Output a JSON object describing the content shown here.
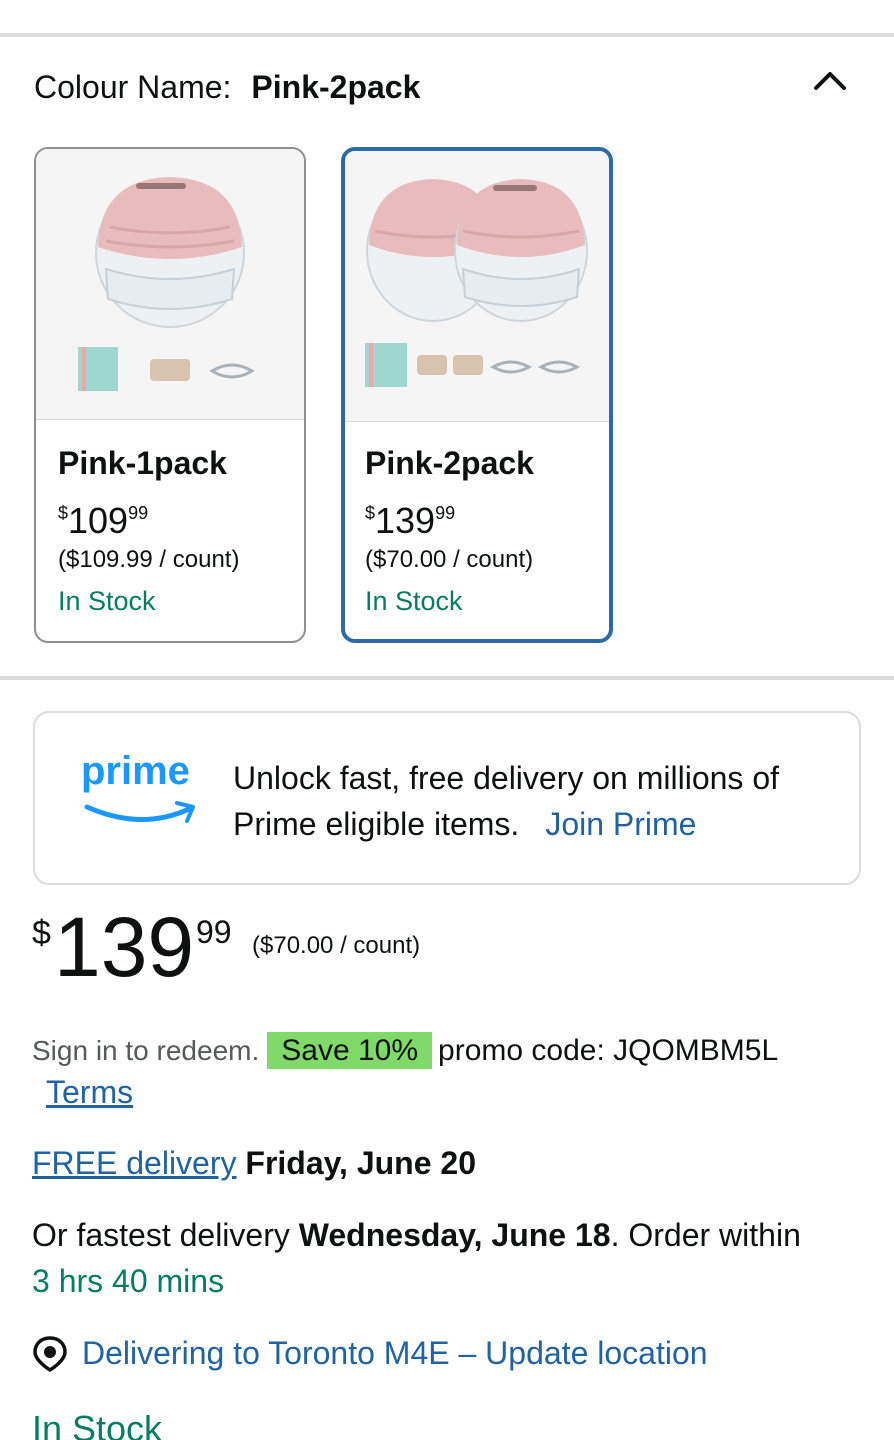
{
  "variation": {
    "label": "Colour Name:",
    "selected_value": "Pink-2pack"
  },
  "swatches": [
    {
      "name": "Pink-1pack",
      "price_symbol": "$",
      "price_whole": "109",
      "price_fraction": "99",
      "unit_price": "($109.99 / count)",
      "availability": "In Stock",
      "selected": false
    },
    {
      "name": "Pink-2pack",
      "price_symbol": "$",
      "price_whole": "139",
      "price_fraction": "99",
      "unit_price": "($70.00 / count)",
      "availability": "In Stock",
      "selected": true
    }
  ],
  "prime": {
    "logo_text": "prime",
    "message": "Unlock fast, free delivery on millions of Prime eligible items.",
    "join_label": "Join Prime"
  },
  "price": {
    "symbol": "$",
    "whole": "139",
    "fraction": "99",
    "unit_price": "($70.00 / count)"
  },
  "promo": {
    "sign_in": "Sign in to redeem.",
    "badge": "Save 10%",
    "code_text": "promo code: JQOMBM5L",
    "terms_label": "Terms"
  },
  "delivery": {
    "free_link": "FREE delivery",
    "free_date": "Friday, June 20",
    "fastest_prefix": "Or fastest delivery",
    "fastest_date": "Wednesday, June 18",
    "order_within_prefix": ". Order within",
    "countdown": "3 hrs 40 mins"
  },
  "location": {
    "text": "Delivering to Toronto M4E – Update location"
  },
  "availability": "In Stock",
  "colors": {
    "link": "#2162a1",
    "in_stock": "#067d62",
    "selected_border": "#2c6aa8",
    "promo_badge": "#7fda69",
    "prime_blue": "#1a98ff"
  }
}
